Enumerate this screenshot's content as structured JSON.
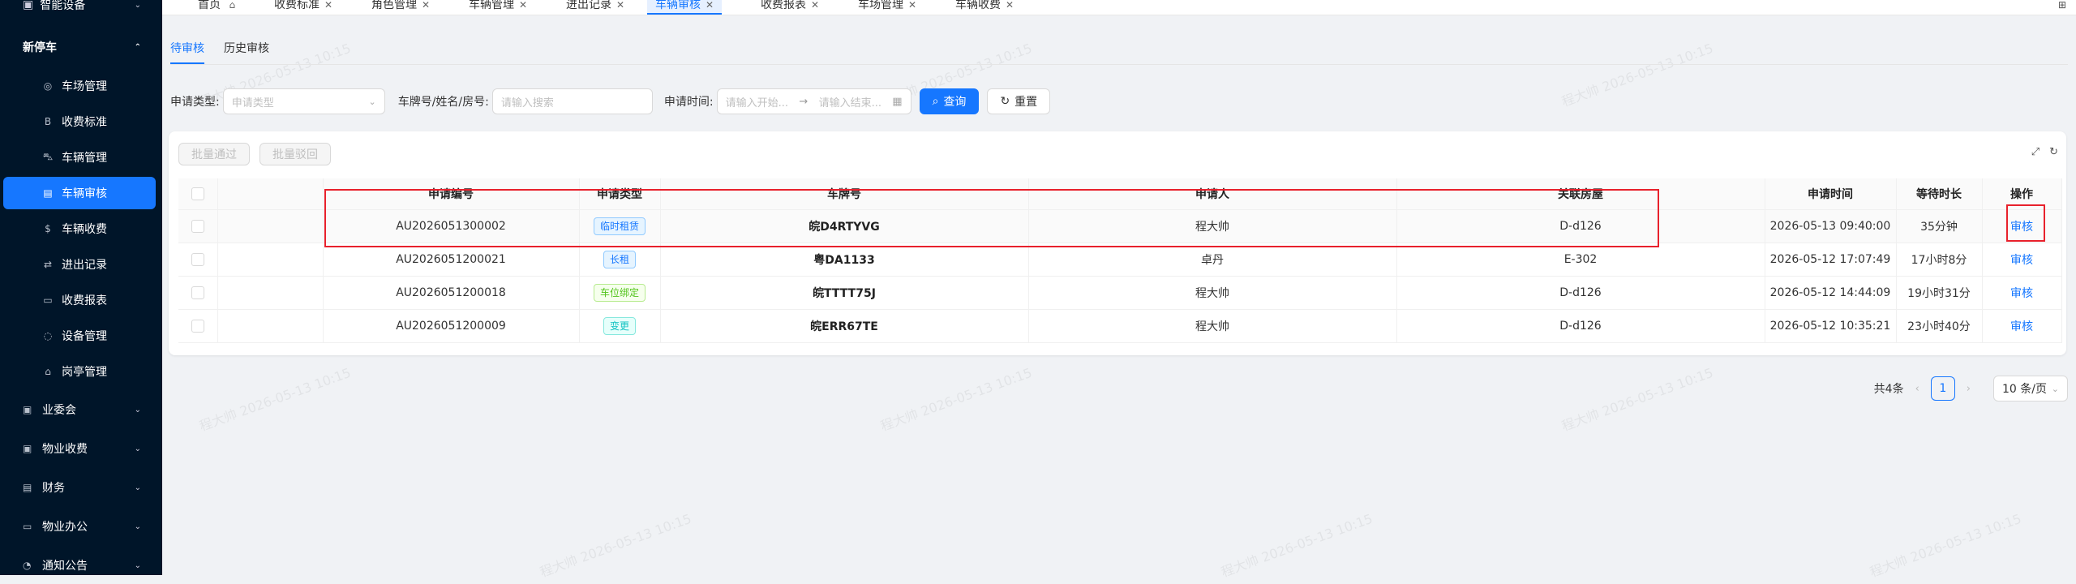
{
  "sidebar": {
    "top_item": "智能设备",
    "open_group": "新停车",
    "sub_items": [
      {
        "icon": "parking-icon",
        "label": "车场管理"
      },
      {
        "icon": "fee-standard-icon",
        "label": "收费标准"
      },
      {
        "icon": "car-icon",
        "label": "车辆管理"
      },
      {
        "icon": "car-audit-icon",
        "label": "车辆审核"
      },
      {
        "icon": "dollar-icon",
        "label": "车辆收费"
      },
      {
        "icon": "entry-exit-icon",
        "label": "进出记录"
      },
      {
        "icon": "report-icon",
        "label": "收费报表"
      },
      {
        "icon": "device-icon",
        "label": "设备管理"
      },
      {
        "icon": "booth-icon",
        "label": "岗亭管理"
      }
    ],
    "lower_groups": [
      {
        "icon": "committee-icon",
        "label": "业委会"
      },
      {
        "icon": "property-fee-icon",
        "label": "物业收费"
      },
      {
        "icon": "finance-icon",
        "label": "财务"
      },
      {
        "icon": "office-icon",
        "label": "物业办公"
      },
      {
        "icon": "notice-icon",
        "label": "通知公告"
      }
    ]
  },
  "tabs": [
    {
      "label": "首页",
      "closable": false
    },
    {
      "label": "收费标准",
      "closable": true
    },
    {
      "label": "角色管理",
      "closable": true
    },
    {
      "label": "车辆管理",
      "closable": true
    },
    {
      "label": "进出记录",
      "closable": true
    },
    {
      "label": "车辆审核",
      "closable": true,
      "active": true
    },
    {
      "label": "收费报表",
      "closable": true
    },
    {
      "label": "车场管理",
      "closable": true
    },
    {
      "label": "车辆收费",
      "closable": true
    }
  ],
  "subtabs": {
    "pending": "待审核",
    "history": "历史审核"
  },
  "filter": {
    "type_label": "申请类型:",
    "type_placeholder": "申请类型",
    "plate_label": "车牌号/姓名/房号:",
    "plate_placeholder": "请输入搜索",
    "time_label": "申请时间:",
    "time_start_placeholder": "请输入开始...",
    "time_end_placeholder": "请输入结束...",
    "search_button": "查询",
    "reset_button": "重置"
  },
  "batch": {
    "approve": "批量通过",
    "reject": "批量驳回"
  },
  "table": {
    "headers": [
      "申请编号",
      "申请类型",
      "车牌号",
      "申请人",
      "关联房屋",
      "申请时间",
      "等待时长",
      "操作"
    ],
    "rows": [
      {
        "id": "AU2026051300002",
        "type": "临时租赁",
        "type_color": "blue",
        "plate": "皖D4RTYVG",
        "applicant": "程大帅",
        "house": "D-d126",
        "time": "2026-05-13 09:40:00",
        "wait": "35分钟",
        "action": "审核"
      },
      {
        "id": "AU2026051200021",
        "type": "长租",
        "type_color": "blue",
        "plate": "粤DA1133",
        "applicant": "卓丹",
        "house": "E-302",
        "time": "2026-05-12 17:07:49",
        "wait": "17小时8分",
        "action": "审核"
      },
      {
        "id": "AU2026051200018",
        "type": "车位绑定",
        "type_color": "green",
        "plate": "皖TTTT75J",
        "applicant": "程大帅",
        "house": "D-d126",
        "time": "2026-05-12 14:44:09",
        "wait": "19小时31分",
        "action": "审核"
      },
      {
        "id": "AU2026051200009",
        "type": "变更",
        "type_color": "cyan",
        "plate": "皖ERR67TE",
        "applicant": "程大帅",
        "house": "D-d126",
        "time": "2026-05-12 10:35:21",
        "wait": "23小时40分",
        "action": "审核"
      }
    ]
  },
  "pagination": {
    "total": "共4条",
    "current": "1",
    "page_size": "10 条/页"
  },
  "watermark": "程大帅 2026-05-13 10:15"
}
